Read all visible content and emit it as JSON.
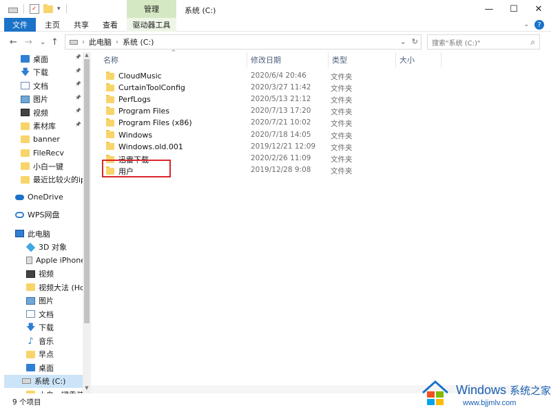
{
  "titlebar": {
    "manage_tab": "管理",
    "window_title": "系统 (C:)",
    "minimize": "—",
    "maximize": "☐",
    "close": "✕"
  },
  "ribbon": {
    "tabs": [
      "文件",
      "主页",
      "共享",
      "查看",
      "驱动器工具"
    ],
    "help": "?"
  },
  "nav": {
    "back": "←",
    "forward": "→",
    "recent": "⌄",
    "up": "↑",
    "breadcrumb": [
      "此电脑",
      "系统 (C:)"
    ],
    "search_placeholder": "搜索\"系统 (C:)\""
  },
  "sidebar": {
    "items": [
      {
        "label": "桌面",
        "icon": "desktop-icon",
        "pinned": true
      },
      {
        "label": "下载",
        "icon": "download-icon",
        "pinned": true
      },
      {
        "label": "文档",
        "icon": "document-icon",
        "pinned": true
      },
      {
        "label": "图片",
        "icon": "picture-icon",
        "pinned": true
      },
      {
        "label": "视频",
        "icon": "video-icon",
        "pinned": true
      },
      {
        "label": "素材库",
        "icon": "folder-icon",
        "pinned": true
      },
      {
        "label": "banner",
        "icon": "folder-icon",
        "pinned": false
      },
      {
        "label": "FileRecv",
        "icon": "folder-icon",
        "pinned": false
      },
      {
        "label": "小白一键",
        "icon": "folder-icon",
        "pinned": false
      },
      {
        "label": "最近比较火的ipl",
        "icon": "folder-icon",
        "pinned": false
      },
      {
        "label": "OneDrive",
        "icon": "cloud-icon",
        "pinned": false
      },
      {
        "label": "WPS网盘",
        "icon": "wps-cloud-icon",
        "pinned": false
      },
      {
        "label": "此电脑",
        "icon": "computer-icon",
        "pinned": false
      },
      {
        "label": "3D 对象",
        "icon": "3d-objects-icon",
        "pinned": false
      },
      {
        "label": "Apple iPhone",
        "icon": "phone-icon",
        "pinned": false
      },
      {
        "label": "视频",
        "icon": "video-icon",
        "pinned": false
      },
      {
        "label": "视频大法 (Hc)",
        "icon": "folder-icon",
        "pinned": false
      },
      {
        "label": "图片",
        "icon": "picture-icon",
        "pinned": false
      },
      {
        "label": "文档",
        "icon": "document-icon",
        "pinned": false
      },
      {
        "label": "下载",
        "icon": "download-icon",
        "pinned": false
      },
      {
        "label": "音乐",
        "icon": "music-icon",
        "pinned": false
      },
      {
        "label": "早点",
        "icon": "folder-icon",
        "pinned": false
      },
      {
        "label": "桌面",
        "icon": "desktop-icon",
        "pinned": false
      },
      {
        "label": "系统 (C:)",
        "icon": "drive-icon",
        "pinned": false,
        "selected": true
      },
      {
        "label": "小白一键重装系统",
        "icon": "folder-icon",
        "pinned": false
      }
    ]
  },
  "columns": {
    "name": "名称",
    "date": "修改日期",
    "type": "类型",
    "size": "大小"
  },
  "files": [
    {
      "name": "CloudMusic",
      "date": "2020/6/4 20:46",
      "type": "文件夹"
    },
    {
      "name": "CurtainToolConfig",
      "date": "2020/3/27 11:42",
      "type": "文件夹"
    },
    {
      "name": "PerfLogs",
      "date": "2020/5/13 21:12",
      "type": "文件夹"
    },
    {
      "name": "Program Files",
      "date": "2020/7/13 17:20",
      "type": "文件夹"
    },
    {
      "name": "Program Files (x86)",
      "date": "2020/7/21 10:02",
      "type": "文件夹"
    },
    {
      "name": "Windows",
      "date": "2020/7/18 14:05",
      "type": "文件夹"
    },
    {
      "name": "Windows.old.001",
      "date": "2019/12/21 12:09",
      "type": "文件夹"
    },
    {
      "name": "迅雷下载",
      "date": "2020/2/26 11:09",
      "type": "文件夹"
    },
    {
      "name": "用户",
      "date": "2019/12/28 9:08",
      "type": "文件夹"
    }
  ],
  "status": {
    "item_count": "9 个项目"
  },
  "watermark": {
    "title": "Windows",
    "title_cn": "系统之家",
    "url": "www.bjjmlv.com"
  },
  "colors": {
    "accent": "#1a73c8",
    "manage_tab": "#d4e8c4",
    "selected": "#cce4f7",
    "folder": "#f8d56b",
    "highlight": "#d9262b"
  }
}
